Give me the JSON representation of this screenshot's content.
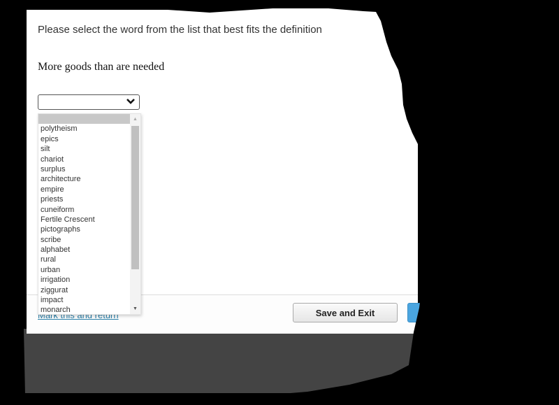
{
  "question": {
    "instruction": "Please select the word from the list that best fits the definition",
    "definition": "More goods than are needed"
  },
  "select": {
    "selected_value": "",
    "highlighted_index": 0,
    "options": [
      "",
      "polytheism",
      "epics",
      "silt",
      "chariot",
      "surplus",
      "architecture",
      "empire",
      "priests",
      "cuneiform",
      "Fertile Crescent",
      "pictographs",
      "scribe",
      "alphabet",
      "rural",
      "urban",
      "irrigation",
      "ziggurat",
      "impact",
      "monarch"
    ]
  },
  "footer": {
    "mark_link": "Mark this and return",
    "save_exit_label": "Save and Exit",
    "next_label": ""
  },
  "colors": {
    "link": "#2a7fa8",
    "primary_button": "#4aa5e0",
    "highlight": "#c8c8c8"
  }
}
